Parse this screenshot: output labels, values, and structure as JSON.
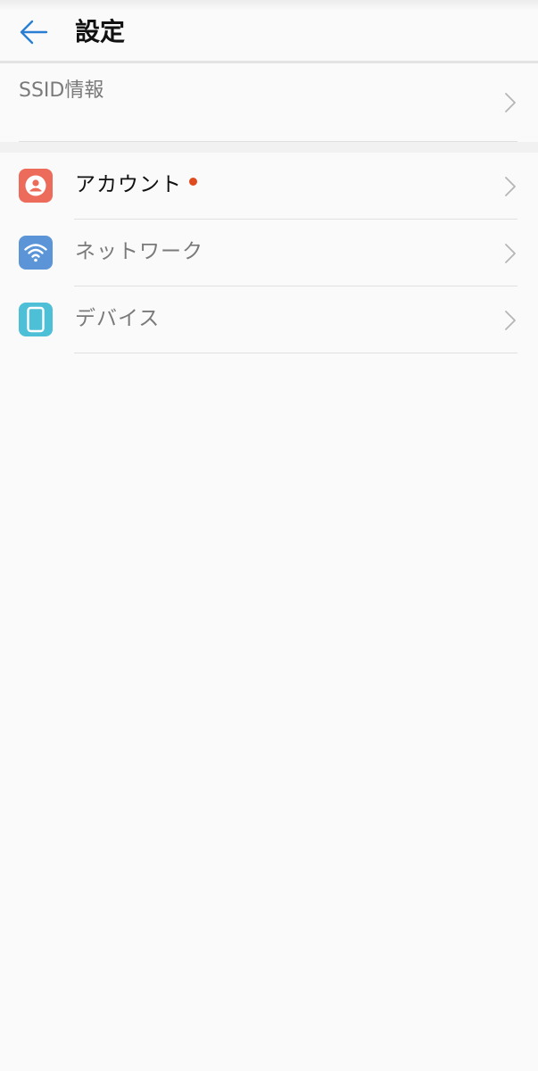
{
  "header": {
    "title": "設定",
    "back_icon": "arrow-left-icon",
    "accent_color": "#2a7fd4"
  },
  "ssid": {
    "label": "SSID情報",
    "icon": "chevron-right-icon"
  },
  "menu": {
    "items": [
      {
        "label": "アカウント",
        "icon": "account-icon",
        "icon_color": "#ec6b5b",
        "label_color": "#111111",
        "has_notification": true,
        "notification_color": "#e04a1f"
      },
      {
        "label": "ネットワーク",
        "icon": "wifi-icon",
        "icon_color": "#5b95d8",
        "label_color": "#7a7a7a",
        "has_notification": false
      },
      {
        "label": "デバイス",
        "icon": "device-icon",
        "icon_color": "#4dbfd6",
        "label_color": "#7a7a7a",
        "has_notification": false
      }
    ]
  }
}
